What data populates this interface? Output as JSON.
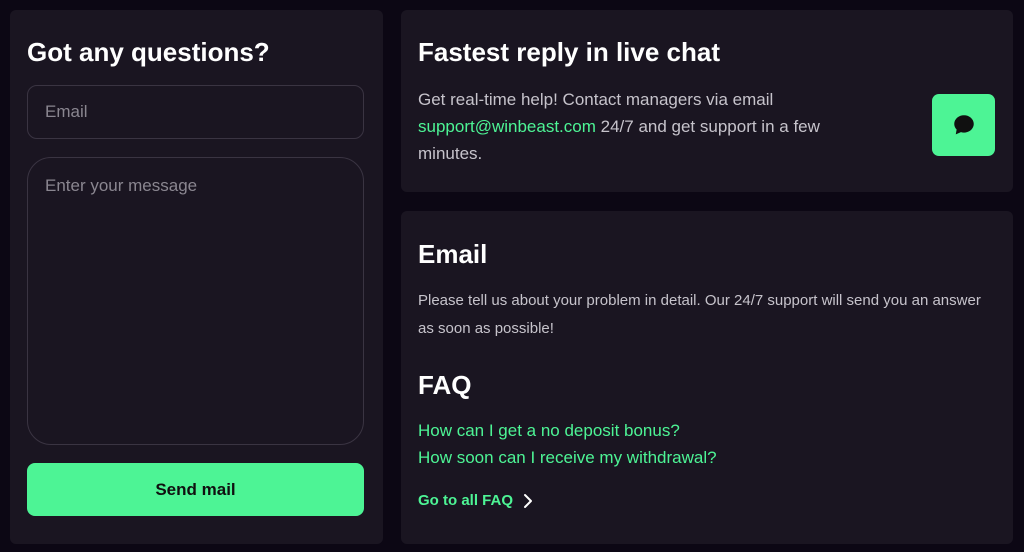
{
  "contact_form": {
    "title": "Got any questions?",
    "email_placeholder": "Email",
    "message_placeholder": "Enter your message",
    "send_label": "Send mail"
  },
  "live_chat": {
    "title": "Fastest reply in live chat",
    "text_before_email": "Get real-time help! Contact managers via email ",
    "support_email": "support@winbeast.com",
    "text_after_email": " 24/7 and get support in a few minutes.",
    "chat_icon": "chat-bubble-icon"
  },
  "email_section": {
    "title": "Email",
    "description": "Please tell us about your problem in detail. Our 24/7 support will send you an answer as soon as possible!"
  },
  "faq": {
    "title": "FAQ",
    "questions": [
      "How can I get a no deposit bonus?",
      "How soon can I receive my withdrawal?"
    ],
    "all_link_label": "Go to all FAQ",
    "arrow_icon": "chevron-right-icon"
  },
  "colors": {
    "background": "#0c0714",
    "panel": "#1a1521",
    "accent": "#4df495"
  }
}
